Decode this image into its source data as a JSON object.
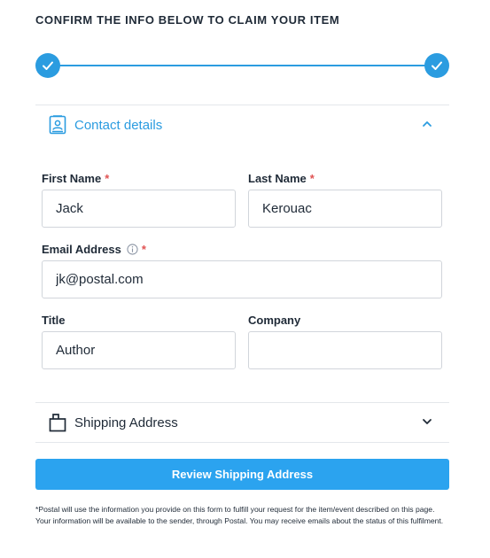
{
  "heading": "CONFIRM THE INFO BELOW TO CLAIM YOUR ITEM",
  "colors": {
    "accent": "#2b9ce0",
    "button": "#2ba3ef",
    "required": "#e05252"
  },
  "stepper": {
    "steps": [
      {
        "icon": "check-icon",
        "state": "complete"
      },
      {
        "icon": "check-icon",
        "state": "complete"
      }
    ]
  },
  "contact_section": {
    "title": "Contact details",
    "icon": "contact-card-icon",
    "expanded": true
  },
  "fields": {
    "first_name": {
      "label": "First Name",
      "required_mark": "*",
      "value": "Jack"
    },
    "last_name": {
      "label": "Last Name",
      "required_mark": "*",
      "value": "Kerouac"
    },
    "email": {
      "label": "Email Address",
      "required_mark": "*",
      "value": "jk@postal.com",
      "icon": "info-icon"
    },
    "title": {
      "label": "Title",
      "value": "Author"
    },
    "company": {
      "label": "Company",
      "value": ""
    }
  },
  "shipping_section": {
    "title": "Shipping Address",
    "icon": "package-icon",
    "expanded": false
  },
  "button_label": "Review Shipping Address",
  "disclaimer": "*Postal will use the information you provide on this form to fulfill your request for the item/event described on this page. Your information will be available to the sender, through Postal. You may receive emails about the status of this fulfilment."
}
